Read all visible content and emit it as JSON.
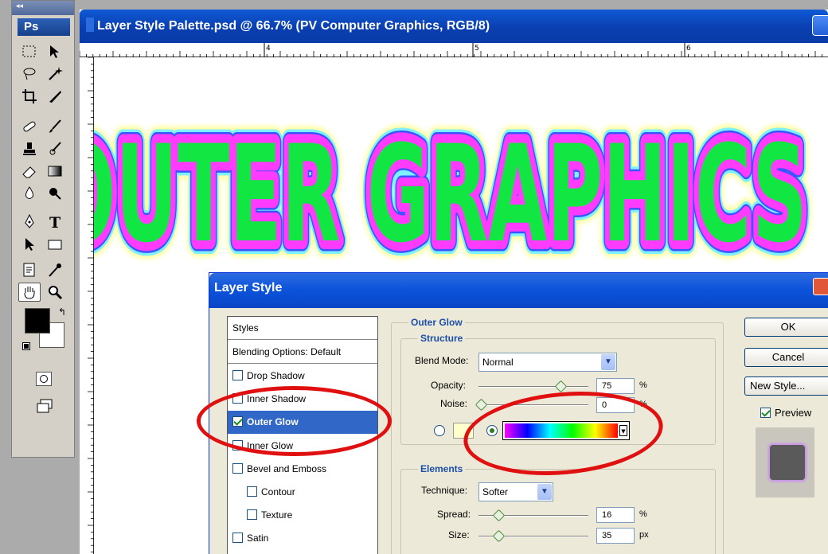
{
  "toolbox": {
    "collapse_glyph": "◂◂",
    "app_logo": "Ps"
  },
  "document": {
    "title": "Layer Style Palette.psd @ 66.7% (PV Computer Graphics, RGB/8)",
    "ruler_marks": [
      "4",
      "5",
      "6"
    ],
    "canvas_text": "OUTER GRAPHICS"
  },
  "dialog": {
    "title": "Layer Style",
    "styles_header": "Styles",
    "blending": "Blending Options: Default",
    "items": [
      {
        "label": "Drop Shadow",
        "checked": false
      },
      {
        "label": "Inner Shadow",
        "checked": false
      },
      {
        "label": "Outer Glow",
        "checked": true
      },
      {
        "label": "Inner Glow",
        "checked": false
      },
      {
        "label": "Bevel and Emboss",
        "checked": false
      },
      {
        "label": "Contour",
        "checked": false
      },
      {
        "label": "Texture",
        "checked": false
      },
      {
        "label": "Satin",
        "checked": false
      }
    ],
    "outer_glow_title": "Outer Glow",
    "structure_title": "Structure",
    "blend_mode_label": "Blend Mode:",
    "blend_mode_value": "Normal",
    "opacity_label": "Opacity:",
    "opacity_value": "75",
    "noise_label": "Noise:",
    "noise_value": "0",
    "percent": "%",
    "elements_title": "Elements",
    "technique_label": "Technique:",
    "technique_value": "Softer",
    "spread_label": "Spread:",
    "spread_value": "16",
    "size_label": "Size:",
    "size_value": "35",
    "px": "px",
    "ok": "OK",
    "cancel": "Cancel",
    "new_style": "New Style...",
    "preview": "Preview",
    "gradient_colors": [
      "#ff00ff",
      "#0000ff",
      "#00ffff",
      "#00ff00",
      "#ffff00",
      "#ff0000"
    ],
    "glow_color": "#ffffcc"
  },
  "colors": {
    "text_fill": "#12e642",
    "glow_magenta": "#ff3bff",
    "annotation": "#e01010"
  }
}
